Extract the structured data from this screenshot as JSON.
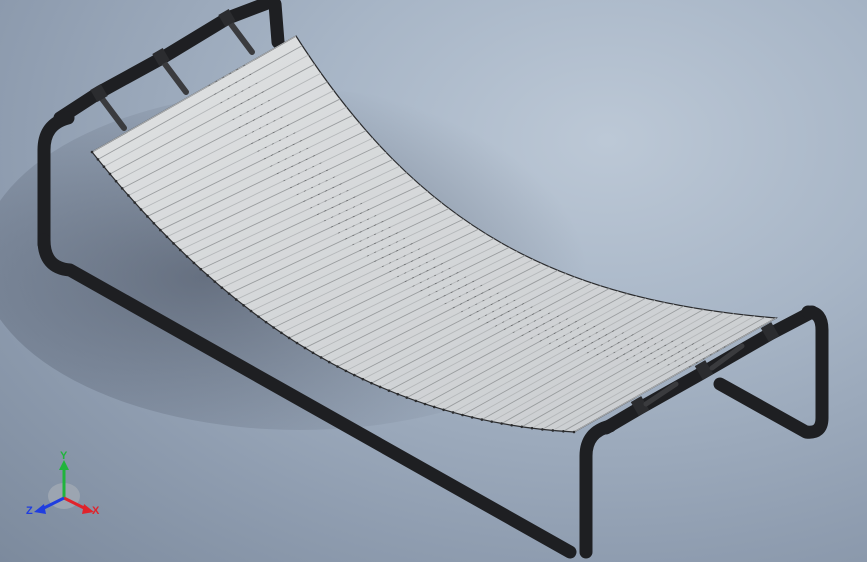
{
  "viewport": {
    "background_top": "#bcc8d6",
    "background_bottom": "#7c8a9d",
    "frame_color": "#1e1f22",
    "slat_color": "#cfd2d4",
    "slat_edge_color": "#2a2b2d",
    "slat_count": 60
  },
  "triad": {
    "x_label": "X",
    "y_label": "Y",
    "z_label": "Z",
    "x_color": "#e0232b",
    "y_color": "#20b43c",
    "z_color": "#1f3de0"
  }
}
